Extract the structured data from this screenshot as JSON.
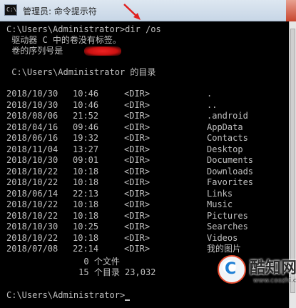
{
  "window": {
    "title": "管理员: 命令提示符",
    "icon_label": "C:\\"
  },
  "console": {
    "command_line": "C:\\Users\\Administrator>dir /os",
    "volume_line": " 驱动器 C 中的卷没有标签。",
    "serial_line": " 卷的序列号是 ",
    "dir_of_line": " C:\\Users\\Administrator 的目录",
    "entries": [
      {
        "date": "2018/10/30",
        "time": "10:46",
        "type": "<DIR>",
        "name": "."
      },
      {
        "date": "2018/10/30",
        "time": "10:46",
        "type": "<DIR>",
        "name": ".."
      },
      {
        "date": "2018/08/06",
        "time": "21:52",
        "type": "<DIR>",
        "name": ".android"
      },
      {
        "date": "2018/04/16",
        "time": "09:46",
        "type": "<DIR>",
        "name": "AppData"
      },
      {
        "date": "2018/06/16",
        "time": "19:32",
        "type": "<DIR>",
        "name": "Contacts"
      },
      {
        "date": "2018/11/04",
        "time": "13:27",
        "type": "<DIR>",
        "name": "Desktop"
      },
      {
        "date": "2018/10/30",
        "time": "09:01",
        "type": "<DIR>",
        "name": "Documents"
      },
      {
        "date": "2018/10/22",
        "time": "10:18",
        "type": "<DIR>",
        "name": "Downloads"
      },
      {
        "date": "2018/10/22",
        "time": "10:18",
        "type": "<DIR>",
        "name": "Favorites"
      },
      {
        "date": "2018/06/14",
        "time": "22:13",
        "type": "<DIR>",
        "name": "Links"
      },
      {
        "date": "2018/10/22",
        "time": "10:18",
        "type": "<DIR>",
        "name": "Music"
      },
      {
        "date": "2018/10/22",
        "time": "10:18",
        "type": "<DIR>",
        "name": "Pictures"
      },
      {
        "date": "2018/10/30",
        "time": "10:25",
        "type": "<DIR>",
        "name": "Searches"
      },
      {
        "date": "2018/10/22",
        "time": "10:18",
        "type": "<DIR>",
        "name": "Videos"
      },
      {
        "date": "2018/07/08",
        "time": "22:14",
        "type": "<DIR>",
        "name": "我的图片"
      }
    ],
    "files_summary": "               0 个文件",
    "dirs_summary": "              15 个目录 23,032",
    "prompt": "C:\\Users\\Administrator>"
  },
  "watermark": {
    "brand": "酷知网",
    "url": "www.coozhi.com",
    "logo_letter": "C"
  },
  "colors": {
    "console_bg": "#000000",
    "console_fg": "#c0c0c0",
    "annotation_red": "#e02020"
  }
}
